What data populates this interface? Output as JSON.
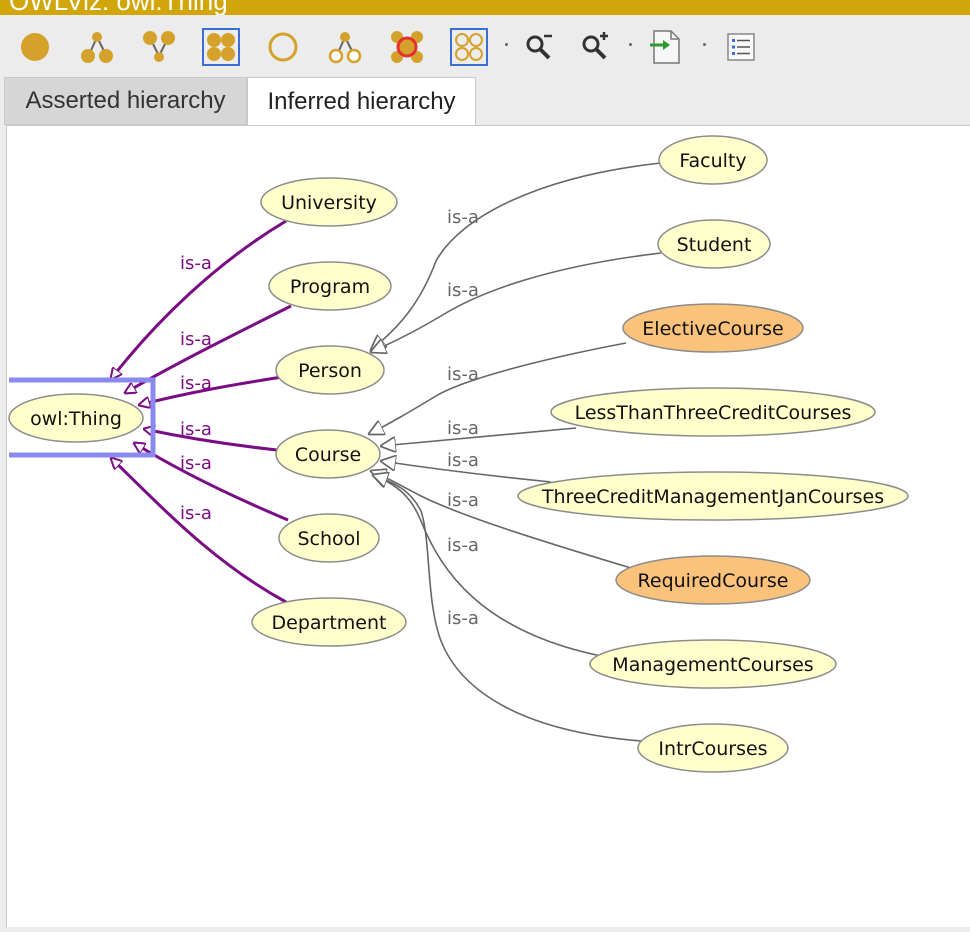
{
  "window": {
    "title": "OWLViz: owl:Thing"
  },
  "toolbar": {
    "buttons": [
      {
        "icon": "filled-circle-icon"
      },
      {
        "icon": "show-subclasses-icon"
      },
      {
        "icon": "show-superclasses-icon"
      },
      {
        "icon": "show-all-classes-icon",
        "selected": true
      },
      {
        "icon": "hollow-circle-icon"
      },
      {
        "icon": "hide-subclasses-icon"
      },
      {
        "icon": "hide-class-icon"
      },
      {
        "icon": "hide-all-classes-icon",
        "selected": true
      },
      {
        "icon": "zoom-out-icon"
      },
      {
        "icon": "zoom-in-icon"
      },
      {
        "icon": "export-image-icon"
      },
      {
        "icon": "options-icon"
      }
    ]
  },
  "tabs": [
    {
      "label": "Asserted hierarchy",
      "active": false
    },
    {
      "label": "Inferred hierarchy",
      "active": true
    }
  ],
  "graph": {
    "edge_label": "is-a",
    "colors": {
      "node_fill": "#ffffcc",
      "node_fill_highlight": "#fbc27c",
      "asserted_edge": "#7a0c84",
      "inferred_edge": "#666666",
      "selection": "#8a8aee"
    },
    "selected_node": "owl:Thing",
    "nodes": [
      {
        "id": "thing",
        "label": "owl:Thing",
        "highlight": false
      },
      {
        "id": "university",
        "label": "University",
        "highlight": false
      },
      {
        "id": "program",
        "label": "Program",
        "highlight": false
      },
      {
        "id": "person",
        "label": "Person",
        "highlight": false
      },
      {
        "id": "course",
        "label": "Course",
        "highlight": false
      },
      {
        "id": "school",
        "label": "School",
        "highlight": false
      },
      {
        "id": "department",
        "label": "Department",
        "highlight": false
      },
      {
        "id": "faculty",
        "label": "Faculty",
        "highlight": false
      },
      {
        "id": "student",
        "label": "Student",
        "highlight": false
      },
      {
        "id": "elective",
        "label": "ElectiveCourse",
        "highlight": true
      },
      {
        "id": "lessthan",
        "label": "LessThanThreeCreditCourses",
        "highlight": false
      },
      {
        "id": "threecredit",
        "label": "ThreeCreditManagementJanCourses",
        "highlight": false
      },
      {
        "id": "required",
        "label": "RequiredCourse",
        "highlight": true
      },
      {
        "id": "management",
        "label": "ManagementCourses",
        "highlight": false
      },
      {
        "id": "intr",
        "label": "IntrCourses",
        "highlight": false
      }
    ],
    "edges": [
      {
        "from": "university",
        "to": "thing",
        "kind": "asserted"
      },
      {
        "from": "program",
        "to": "thing",
        "kind": "asserted"
      },
      {
        "from": "person",
        "to": "thing",
        "kind": "asserted"
      },
      {
        "from": "course",
        "to": "thing",
        "kind": "asserted"
      },
      {
        "from": "school",
        "to": "thing",
        "kind": "asserted"
      },
      {
        "from": "department",
        "to": "thing",
        "kind": "asserted"
      },
      {
        "from": "faculty",
        "to": "person",
        "kind": "inferred"
      },
      {
        "from": "student",
        "to": "person",
        "kind": "inferred"
      },
      {
        "from": "elective",
        "to": "course",
        "kind": "inferred"
      },
      {
        "from": "lessthan",
        "to": "course",
        "kind": "inferred"
      },
      {
        "from": "threecredit",
        "to": "course",
        "kind": "inferred"
      },
      {
        "from": "required",
        "to": "course",
        "kind": "inferred"
      },
      {
        "from": "management",
        "to": "course",
        "kind": "inferred"
      },
      {
        "from": "intr",
        "to": "course",
        "kind": "inferred"
      }
    ]
  }
}
